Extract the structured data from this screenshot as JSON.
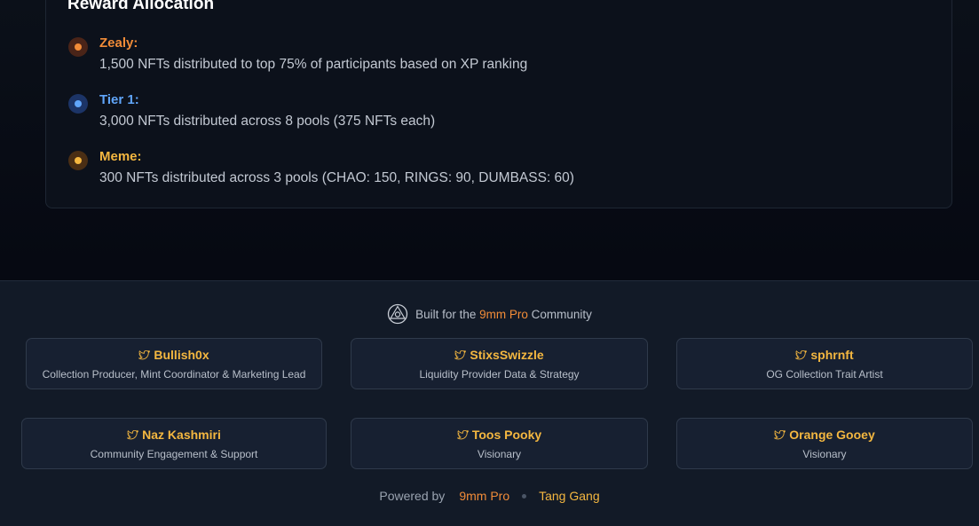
{
  "reward_allocation": {
    "title": "Reward Allocation",
    "items": [
      {
        "name": "Zealy:",
        "description": "1,500 NFTs distributed to top 75% of participants based on XP ranking",
        "color": "#f28c38",
        "dot_bg": "#4a2418"
      },
      {
        "name": "Tier 1:",
        "description": "3,000 NFTs distributed across 8 pools (375 NFTs each)",
        "color": "#60a5fa",
        "dot_bg": "#1c3467"
      },
      {
        "name": "Meme:",
        "description": "300 NFTs distributed across 3 pools (CHAO: 150, RINGS: 90, DUMBASS: 60)",
        "color": "#f4b740",
        "dot_bg": "#4a2e14"
      }
    ]
  },
  "footer": {
    "built_prefix": "Built for the",
    "built_brand": "9mm Pro",
    "built_suffix": "Community",
    "credits": [
      {
        "name": "Bullish0x",
        "role": "Collection Producer, Mint Coordinator & Marketing Lead"
      },
      {
        "name": "StixsSwizzle",
        "role": "Liquidity Provider Data & Strategy"
      },
      {
        "name": "sphrnft",
        "role": "OG Collection Trait Artist"
      },
      {
        "name": "Naz Kashmiri",
        "role": "Community Engagement & Support"
      },
      {
        "name": "Toos Pooky",
        "role": "Visionary"
      },
      {
        "name": "Orange Gooey",
        "role": "Visionary"
      }
    ],
    "powered_label": "Powered by",
    "powered_links": [
      "9mm Pro",
      "Tang Gang"
    ]
  },
  "colors": {
    "accent_orange": "#f28c38",
    "accent_gold": "#f4b740",
    "accent_blue": "#60a5fa"
  },
  "icons": {
    "credit_icon": "twitter-bird-icon",
    "built_logo": "9mm-logo-icon"
  }
}
